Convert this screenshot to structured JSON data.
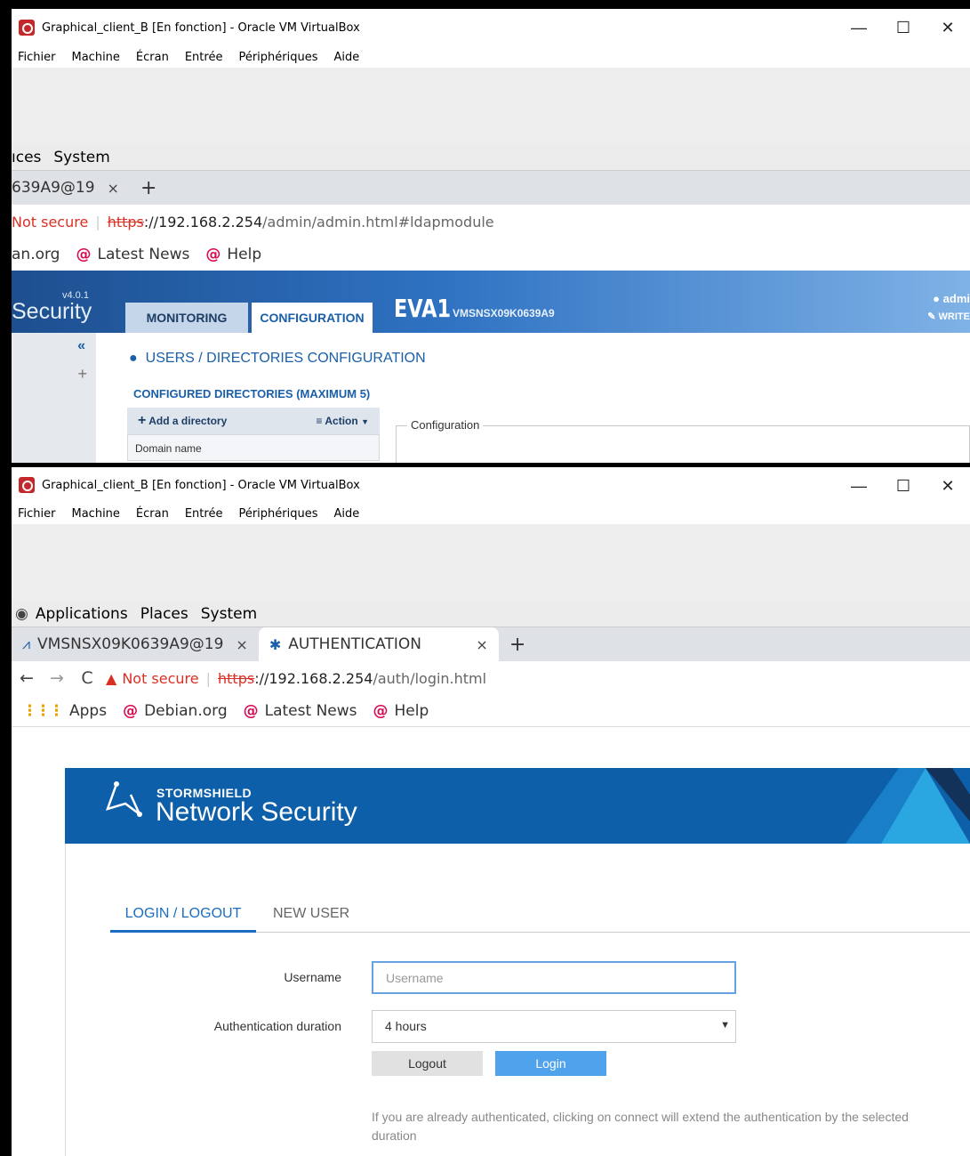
{
  "window1": {
    "title": "Graphical_client_B [En fonction] - Oracle VM VirtualBox",
    "controls": [
      "—",
      "☐",
      "✕"
    ],
    "menu": [
      "Fichier",
      "Machine",
      "Écran",
      "Entrée",
      "Périphériques",
      "Aide"
    ],
    "gnome_menu": [
      "ıces",
      "System"
    ],
    "tab": {
      "title": "639A9@19",
      "close": "×"
    },
    "new_tab": "+",
    "address": {
      "not_secure": "Not secure",
      "scheme": "https",
      "host": "://192.168.2.254",
      "path": "/admin/admin.html#ldapmodule"
    },
    "bookmarks": [
      "an.org",
      "Latest News",
      "Help"
    ],
    "sns": {
      "version": "v4.0.1",
      "brand": "Security",
      "tabs": {
        "monitoring": "MONITORING",
        "configuration": "CONFIGURATION"
      },
      "device_name": "EVA1",
      "serial": "VMSNSX09K0639A9",
      "user": "admi",
      "write": "WRITE",
      "collapse": "«",
      "add": "+",
      "section_title": "USERS / DIRECTORIES CONFIGURATION",
      "subsection": "CONFIGURED DIRECTORIES (MAXIMUM 5)",
      "add_directory": "Add a directory",
      "action": "Action",
      "column_domain": "Domain name",
      "configuration_legend": "Configuration"
    }
  },
  "window2": {
    "title": "Graphical_client_B [En fonction] - Oracle VM VirtualBox",
    "controls": [
      "—",
      "☐",
      "✕"
    ],
    "menu": [
      "Fichier",
      "Machine",
      "Écran",
      "Entrée",
      "Périphériques",
      "Aide"
    ],
    "gnome_menu": [
      "Applications",
      "Places",
      "System"
    ],
    "tabs": [
      {
        "title": "VMSNSX09K0639A9@19",
        "close": "×"
      },
      {
        "title": "AUTHENTICATION",
        "close": "×"
      }
    ],
    "new_tab": "+",
    "nav": {
      "back": "←",
      "forward": "→",
      "reload": "C"
    },
    "address": {
      "not_secure": "Not secure",
      "scheme": "https",
      "host": "://192.168.2.254",
      "path": "/auth/login.html"
    },
    "bookmarks": [
      "Apps",
      "Debian.org",
      "Latest News",
      "Help"
    ],
    "login": {
      "brand_top": "STORMSHIELD",
      "brand_main": "Network Security",
      "tabs": {
        "login": "LOGIN / LOGOUT",
        "new_user": "NEW USER"
      },
      "username_label": "Username",
      "username_placeholder": "Username",
      "duration_label": "Authentication duration",
      "duration_value": "4 hours",
      "logout_button": "Logout",
      "login_button": "Login",
      "note": "If you are already authenticated, clicking on connect will extend the authentication by the selected duration"
    }
  }
}
